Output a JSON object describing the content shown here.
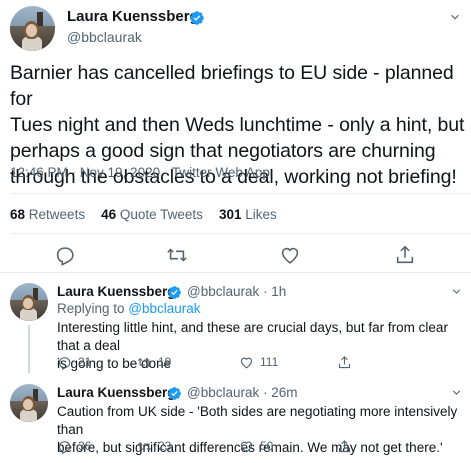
{
  "main_tweet": {
    "author_name": "Laura Kuenssberg",
    "author_handle": "@bbclaurak",
    "text_lines": [
      "Barnier has cancelled briefings to EU side - planned for",
      "Tues night and then Weds lunchtime - only a hint, but",
      "perhaps a good sign that negotiators are churning",
      "through the obstacles to a deal, working not briefing!"
    ],
    "timestamp": "12:46 PM · Nov 19, 2020 · Twitter Web App",
    "retweets_count": "68",
    "retweets_label": "Retweets",
    "quote_count": "46",
    "quote_label": "Quote Tweets",
    "likes_count": "301",
    "likes_label": "Likes"
  },
  "replies": [
    {
      "author_name": "Laura Kuenssberg",
      "author_handle": "@bbclaurak · 1h",
      "replying_prefix": "Replying to ",
      "replying_to": "@bbclaurak",
      "text_lines": [
        "Interesting little hint, and these are crucial days, but far from clear that a deal",
        "is going to be done"
      ],
      "replies": "21",
      "retweets": "19",
      "likes": "111"
    },
    {
      "author_name": "Laura Kuenssberg",
      "author_handle": "@bbclaurak · 26m",
      "text_lines": [
        "Caution from UK side - 'Both sides are negotiating more intensively than",
        "before, but significant differences remain. We may not get there.'"
      ],
      "replies": "36",
      "retweets": "23",
      "likes": "50"
    }
  ],
  "colors": {
    "verified": "#1d9bf0",
    "muted": "#536471",
    "link": "#1d9bf0"
  }
}
